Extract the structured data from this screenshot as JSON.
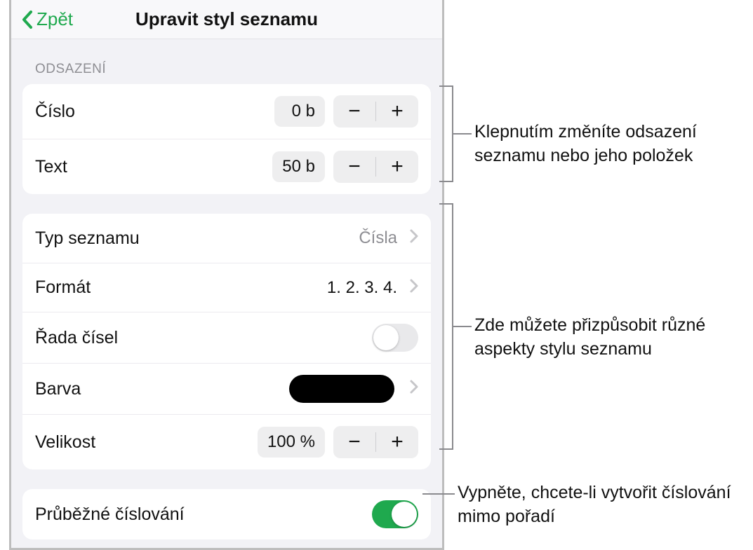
{
  "header": {
    "back_label": "Zpět",
    "title": "Upravit styl seznamu"
  },
  "sections": {
    "odsazeni": {
      "label": "ODSAZENÍ",
      "rows": {
        "cislo": {
          "label": "Číslo",
          "value": "0 b"
        },
        "text": {
          "label": "Text",
          "value": "50 b"
        }
      }
    },
    "style": {
      "rows": {
        "typ": {
          "label": "Typ seznamu",
          "value": "Čísla"
        },
        "format": {
          "label": "Formát",
          "value": "1. 2. 3. 4."
        },
        "rada": {
          "label": "Řada čísel",
          "toggle_on": false
        },
        "barva": {
          "label": "Barva",
          "color": "#000000"
        },
        "velikost": {
          "label": "Velikost",
          "value": "100 %"
        }
      }
    },
    "cislovani": {
      "label": "Průběžné číslování",
      "toggle_on": true
    }
  },
  "stepper": {
    "minus": "−",
    "plus": "+"
  },
  "callouts": {
    "indent": "Klepnutím změníte odsazení seznamu nebo jeho položek",
    "style": "Zde můžete přizpůsobit různé aspekty stylu seznamu",
    "number": "Vypněte, chcete-li vytvořit číslování mimo pořadí"
  }
}
